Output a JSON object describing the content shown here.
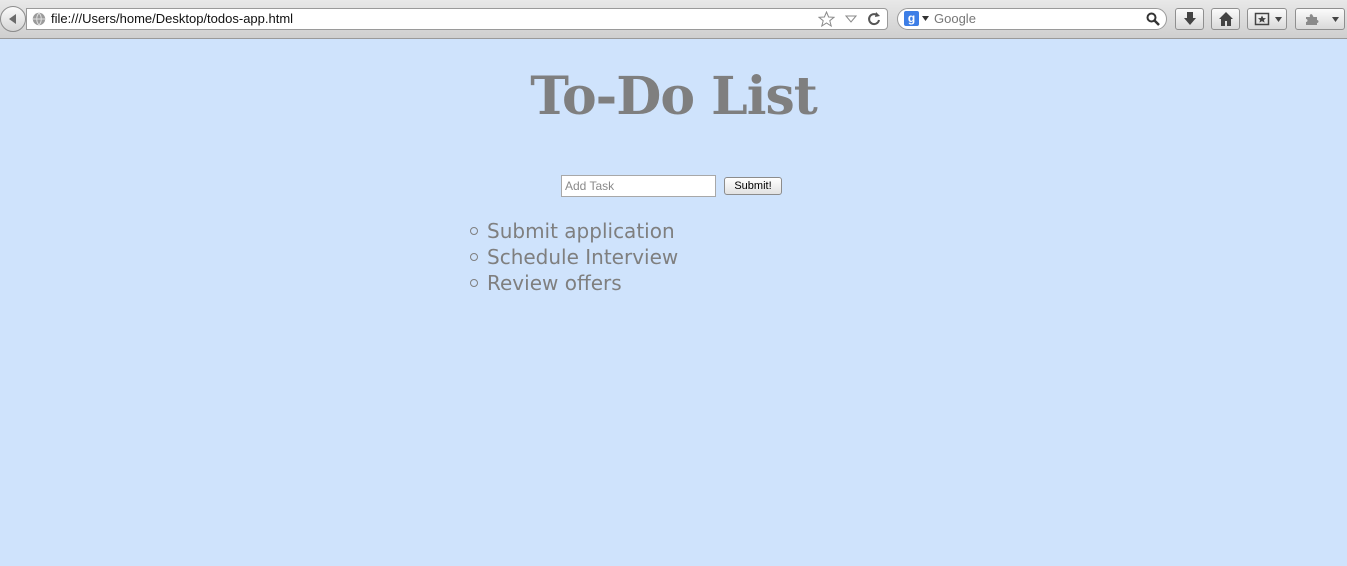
{
  "browser": {
    "address": "file:///Users/home/Desktop/todos-app.html",
    "search_engine_placeholder": "Google",
    "search_engine_letter": "g"
  },
  "page": {
    "title": "To-Do List",
    "task_input_placeholder": "Add Task",
    "task_input_value": "",
    "submit_label": "Submit!",
    "tasks": [
      {
        "label": "Submit application"
      },
      {
        "label": "Schedule Interview"
      },
      {
        "label": "Review offers"
      }
    ]
  },
  "colors": {
    "page_background": "#cfe3fc",
    "text_gray": "#7f7f7f"
  },
  "icons": {
    "back": "back-arrow-icon",
    "site": "globe-icon",
    "bookmark": "star-icon",
    "history": "dropdown-arrow-icon",
    "reload": "reload-icon",
    "search": "magnifier-icon",
    "downloads": "download-arrow-icon",
    "home": "home-icon",
    "bookmarks_menu": "bookmarks-icon",
    "addons": "puzzle-icon"
  }
}
